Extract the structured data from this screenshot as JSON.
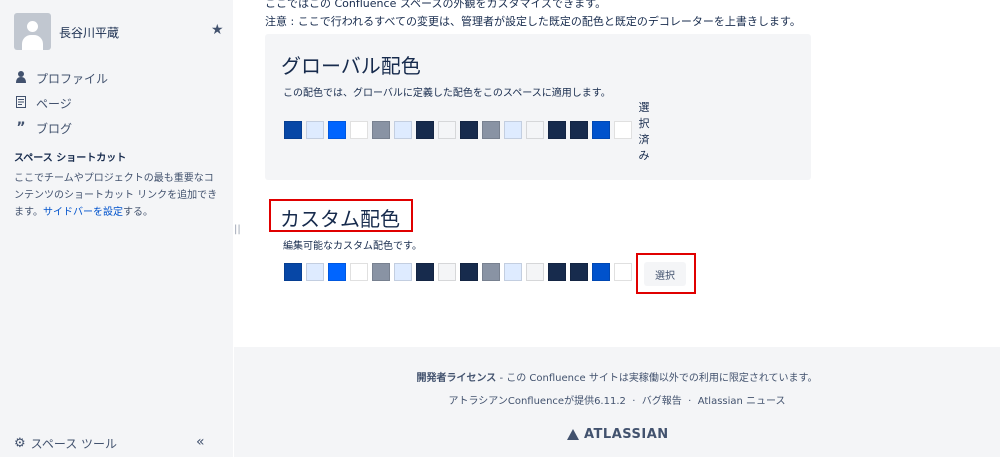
{
  "sidebar": {
    "username": "長谷川平蔵",
    "nav": [
      {
        "label": "プロファイル",
        "icon": "person-icon"
      },
      {
        "label": "ページ",
        "icon": "page-icon"
      },
      {
        "label": "ブログ",
        "icon": "quote-icon"
      }
    ],
    "shortcuts_title": "スペース ショートカット",
    "shortcuts_desc": "ここでチームやプロジェクトの最も重要なコンテンツのショートカット リンクを追加できます。",
    "shortcuts_link": "サイドバーを設定",
    "shortcuts_suffix": "する。",
    "tools_label": "スペース ツール",
    "collapse_label": "«"
  },
  "main": {
    "intro_line1": "ここではこの Confluence スペースの外観をカスタマイズできます。",
    "intro_line2": "注意 : ここで行われるすべての変更は、管理者が設定した既定の配色と既定のデコレーターを上書きします。",
    "global": {
      "title": "グローバル配色",
      "desc": "この配色では、グローバルに定義した配色をこのスペースに適用します。",
      "selected_label": "選択済み"
    },
    "custom": {
      "title": "カスタム配色",
      "desc": "編集可能なカスタム配色です。",
      "select_label": "選択"
    },
    "swatch_colors": [
      "#0747a6",
      "#deebff",
      "#0065ff",
      "#ffffff",
      "#8993a4",
      "#deebff",
      "#172b4d",
      "#f4f5f7",
      "#172b4d",
      "#8993a4",
      "#deebff",
      "#f4f5f7",
      "#172b4d",
      "#172b4d",
      "#0052cc",
      "#ffffff"
    ]
  },
  "footer": {
    "license_bold": "開発者ライセンス",
    "license_rest": " - この Confluence サイトは実稼働以外での利用に限定されています。",
    "powered": "アトラシアンConfluenceが提供6.11.2",
    "sep": "·",
    "bug": "バグ報告",
    "news": "Atlassian ニュース",
    "logo": "ATLASSIAN"
  },
  "colors": {
    "accent": "#0052cc",
    "highlight": "#e00000"
  }
}
